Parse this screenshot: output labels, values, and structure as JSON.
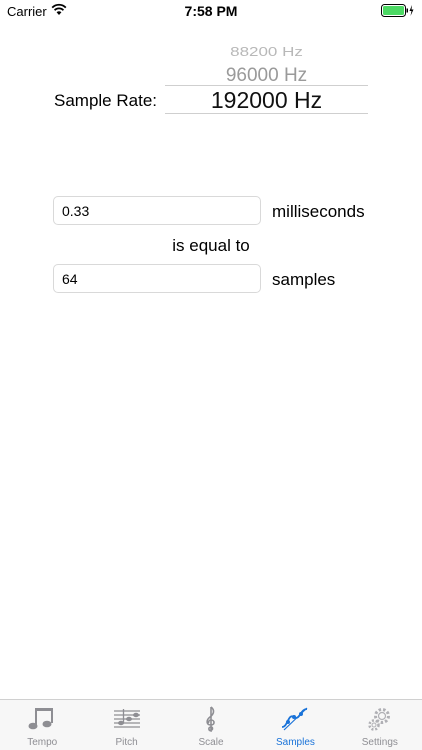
{
  "status_bar": {
    "carrier": "Carrier",
    "time": "7:58 PM"
  },
  "sample_rate": {
    "label": "Sample Rate:",
    "picker_rows": [
      "88200 Hz",
      "96000 Hz"
    ],
    "selected": "192000 Hz"
  },
  "converter": {
    "milliseconds_value": "0.33",
    "milliseconds_unit": "milliseconds",
    "equal_text": "is equal to",
    "samples_value": "64",
    "samples_unit": "samples"
  },
  "tabs": [
    {
      "label": "Tempo",
      "icon": "music-notes-icon",
      "active": false
    },
    {
      "label": "Pitch",
      "icon": "staff-icon",
      "active": false
    },
    {
      "label": "Scale",
      "icon": "treble-clef-icon",
      "active": false
    },
    {
      "label": "Samples",
      "icon": "waveform-icon",
      "active": true
    },
    {
      "label": "Settings",
      "icon": "gears-icon",
      "active": false
    }
  ],
  "colors": {
    "accent": "#1a73d9",
    "inactive": "#8e8e93",
    "battery": "#4cd964"
  }
}
